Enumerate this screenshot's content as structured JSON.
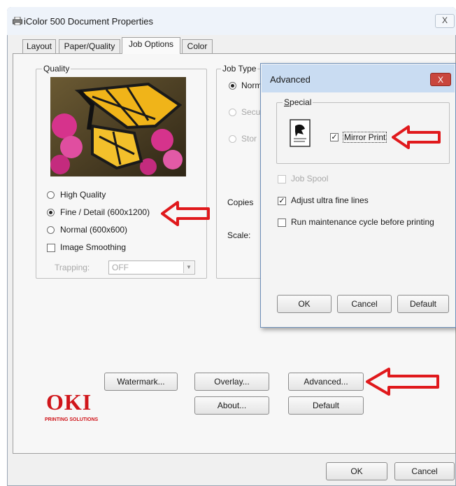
{
  "window": {
    "title": "iColor 500 Document Properties",
    "close_label": "X"
  },
  "tabs": [
    {
      "label": "Layout"
    },
    {
      "label": "Paper/Quality"
    },
    {
      "label": "Job Options"
    },
    {
      "label": "Color"
    }
  ],
  "quality": {
    "legend": "Quality",
    "options": [
      "High Quality",
      "Fine / Detail (600x1200)",
      "Normal (600x600)"
    ],
    "selected": "Fine / Detail (600x1200)",
    "image_smoothing_label": "Image Smoothing",
    "image_smoothing_checked": false,
    "trapping_label": "Trapping:",
    "trapping_value": "OFF"
  },
  "job_type": {
    "legend": "Job Type",
    "options_partial": [
      "Norm",
      "Secu",
      "Stor"
    ]
  },
  "copies_label": "Copies",
  "scale_label": "Scale:",
  "advanced_dialog": {
    "title": "Advanced",
    "close_label": "X",
    "special_legend": "Special",
    "mirror_print_label": "Mirror Print",
    "mirror_print_checked": true,
    "job_spool_label": "Job Spool",
    "adjust_lines_label": "Adjust ultra fine lines",
    "adjust_lines_checked": true,
    "maintenance_label": "Run maintenance cycle before printing",
    "maintenance_checked": false,
    "ok_label": "OK",
    "cancel_label": "Cancel",
    "default_label": "Default"
  },
  "buttons": {
    "watermark": "Watermark...",
    "overlay": "Overlay...",
    "advanced": "Advanced...",
    "about": "About...",
    "default": "Default",
    "ok": "OK",
    "cancel": "Cancel"
  },
  "logo": {
    "brand": "OKI",
    "tagline": "PRINTING SOLUTIONS"
  },
  "colors": {
    "annotation_arrow": "#e0191c",
    "dialog_close": "#c9463d",
    "brand_red": "#d0161b"
  }
}
